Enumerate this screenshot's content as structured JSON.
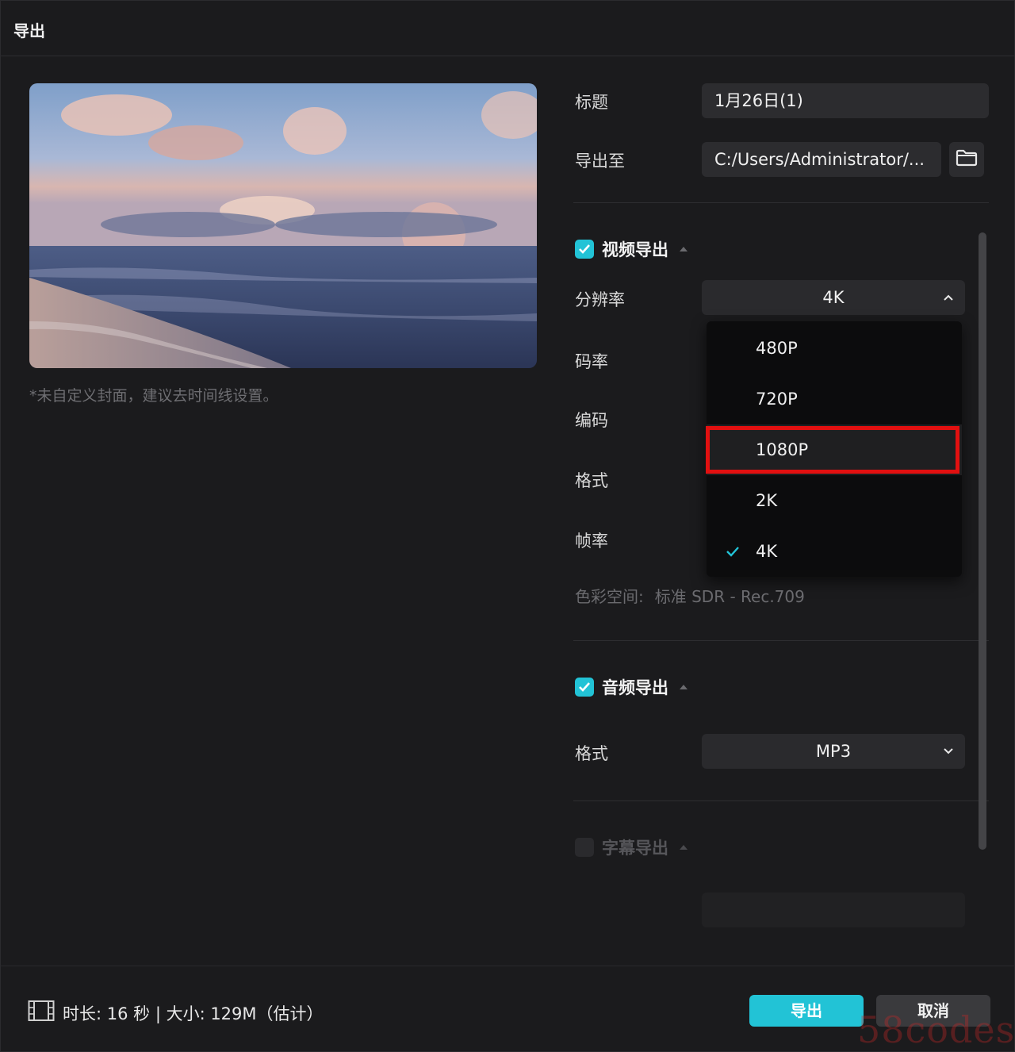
{
  "window": {
    "title": "导出"
  },
  "preview": {
    "cover_hint": "*未自定义封面，建议去时间线设置。"
  },
  "form": {
    "title_label": "标题",
    "title_value": "1月26日(1)",
    "export_to_label": "导出至",
    "export_path": "C:/Users/Administrator/..."
  },
  "video_section": {
    "title": "视频导出",
    "checked": true,
    "resolution_label": "分辨率",
    "resolution_value": "4K",
    "bitrate_label": "码率",
    "codec_label": "编码",
    "format_label": "格式",
    "framerate_label": "帧率",
    "resolution_options": [
      "480P",
      "720P",
      "1080P",
      "2K",
      "4K"
    ],
    "selected_option": "4K",
    "highlighted_option": "1080P",
    "color_space_label": "色彩空间:",
    "color_space_value": "标准 SDR - Rec.709"
  },
  "audio_section": {
    "title": "音频导出",
    "checked": true,
    "format_label": "格式",
    "format_value": "MP3"
  },
  "subtitle_section": {
    "title": "字幕导出",
    "checked": false
  },
  "footer": {
    "info": "时长: 16 秒 | 大小: 129M（估计）",
    "export_button": "导出",
    "cancel_button": "取消"
  },
  "watermark": "58codes",
  "colors": {
    "accent": "#22c3d6",
    "highlight_border": "#e21010",
    "background": "#1b1b1d"
  }
}
